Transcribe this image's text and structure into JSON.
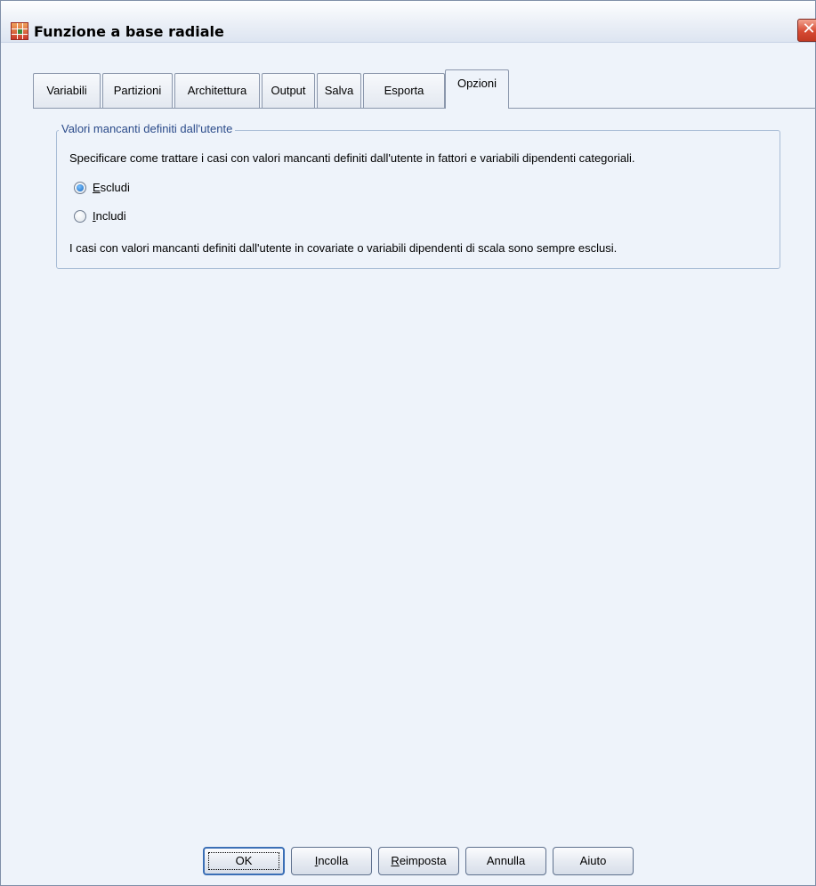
{
  "window": {
    "title": "Funzione a base radiale",
    "icon": "spss-table-icon",
    "close_icon": "close-icon",
    "close_glyph": "✕"
  },
  "tabs": [
    {
      "label": "Variabili",
      "active": false
    },
    {
      "label": "Partizioni",
      "active": false
    },
    {
      "label": "Architettura",
      "active": false
    },
    {
      "label": "Output",
      "active": false
    },
    {
      "label": "Salva",
      "active": false
    },
    {
      "label": "Esporta",
      "active": false
    },
    {
      "label": "Opzioni",
      "active": true
    }
  ],
  "missing_values": {
    "legend": "Valori mancanti definiti dall'utente",
    "description": "Specificare come trattare i casi con valori mancanti definiti dall'utente in fattori e variabili dipendenti categoriali.",
    "options": [
      {
        "mnemonic": "E",
        "rest": "scludi",
        "checked": true
      },
      {
        "mnemonic": "I",
        "rest": "ncludi",
        "checked": false
      }
    ],
    "note": "I casi con valori mancanti definiti dall'utente in covariate o variabili dipendenti di scala sono sempre esclusi."
  },
  "buttons": {
    "ok": "OK",
    "paste_mnemonic": "I",
    "paste_rest": "ncolla",
    "reset_mnemonic": "R",
    "reset_rest": "eimposta",
    "cancel": "Annulla",
    "help": "Aiuto"
  }
}
